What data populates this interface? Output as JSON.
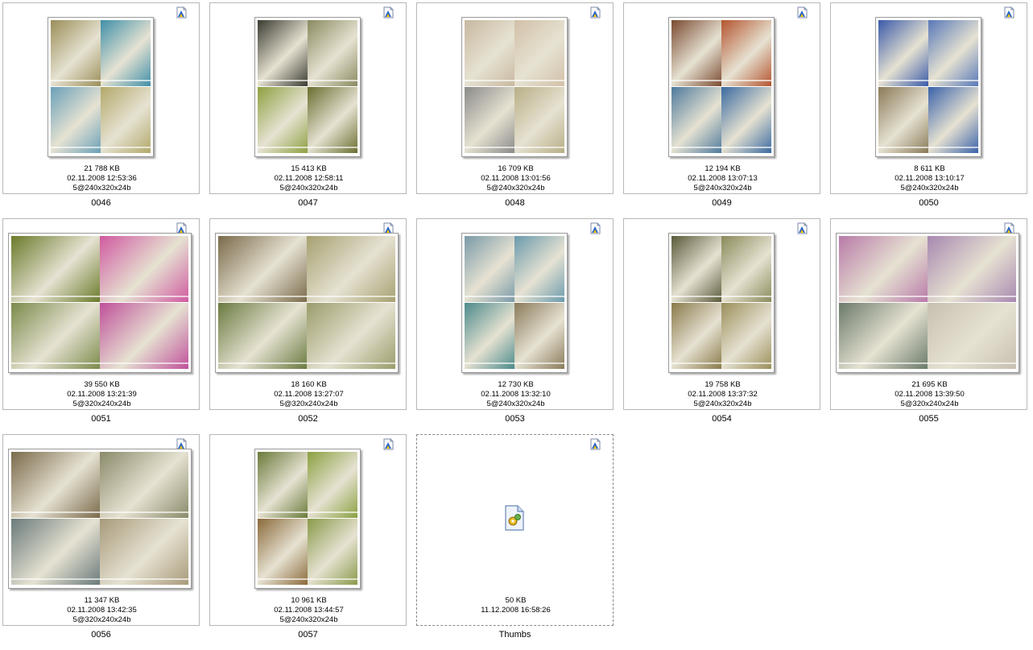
{
  "colors": {
    "border": "#b7b7b7",
    "badge_blue": "#2a63c6",
    "badge_yellow": "#f5c400"
  },
  "badge_icon": "image-file-icon",
  "items": [
    {
      "name": "0046",
      "size": "21 788 KB",
      "date": "02.11.2008 12:53:36",
      "info": "5@240x320x24b",
      "orientation": "portrait",
      "colors": [
        "#9a8e58",
        "#3f8fa8",
        "#6aa0b8",
        "#b2a86a"
      ]
    },
    {
      "name": "0047",
      "size": "15 413 KB",
      "date": "02.11.2008 12:58:11",
      "info": "5@240x320x24b",
      "orientation": "portrait",
      "colors": [
        "#3a3a30",
        "#8a8a60",
        "#8ea040",
        "#6a6e30"
      ]
    },
    {
      "name": "0048",
      "size": "16 709 KB",
      "date": "02.11.2008 13:01:56",
      "info": "5@240x320x24b",
      "orientation": "portrait",
      "colors": [
        "#c8b8a0",
        "#d2c0a8",
        "#8a8a88",
        "#b8ae86"
      ]
    },
    {
      "name": "0049",
      "size": "12 194 KB",
      "date": "02.11.2008 13:07:13",
      "info": "5@240x320x24b",
      "orientation": "portrait",
      "colors": [
        "#7a4a30",
        "#b4542e",
        "#4e7a9c",
        "#3a6aa0"
      ]
    },
    {
      "name": "0050",
      "size": "8 611 KB",
      "date": "02.11.2008 13:10:17",
      "info": "5@240x320x24b",
      "orientation": "portrait",
      "colors": [
        "#3a5aa8",
        "#5878b8",
        "#8a7a58",
        "#3a62aa"
      ]
    },
    {
      "name": "0051",
      "size": "39 550 KB",
      "date": "02.11.2008 13:21:39",
      "info": "5@320x240x24b",
      "orientation": "landscape",
      "colors": [
        "#6a7a2a",
        "#d05aa0",
        "#7a8a4a",
        "#c0509a"
      ]
    },
    {
      "name": "0052",
      "size": "18 160 KB",
      "date": "02.11.2008 13:27:07",
      "info": "5@320x240x24b",
      "orientation": "landscape",
      "colors": [
        "#7a6a4a",
        "#a6a070",
        "#6a7a40",
        "#9a9c6a"
      ]
    },
    {
      "name": "0053",
      "size": "12 730 KB",
      "date": "02.11.2008 13:32:10",
      "info": "5@240x320x24b",
      "orientation": "portrait",
      "colors": [
        "#7a9aa8",
        "#6a9aac",
        "#4a8a8a",
        "#8a7a5a"
      ]
    },
    {
      "name": "0054",
      "size": "19 758 KB",
      "date": "02.11.2008 13:37:32",
      "info": "5@240x320x24b",
      "orientation": "portrait",
      "colors": [
        "#5a5a3a",
        "#8a8a5a",
        "#8a7a4a",
        "#9a8e5a"
      ]
    },
    {
      "name": "0055",
      "size": "21 695 KB",
      "date": "02.11.2008 13:39:50",
      "info": "5@320x240x24b",
      "orientation": "landscape",
      "colors": [
        "#b87aa8",
        "#a888b0",
        "#6a7a6a",
        "#c8c0b0"
      ]
    },
    {
      "name": "0056",
      "size": "11 347 KB",
      "date": "02.11.2008 13:42:35",
      "info": "5@320x240x24b",
      "orientation": "landscape",
      "colors": [
        "#7a6a4a",
        "#8a8a6a",
        "#6a7a7a",
        "#a89a7a"
      ]
    },
    {
      "name": "0057",
      "size": "10 961 KB",
      "date": "02.11.2008 13:44:57",
      "info": "5@240x320x24b",
      "orientation": "portrait",
      "colors": [
        "#6a7a3a",
        "#8aa040",
        "#8a6a3a",
        "#8a9a4a"
      ]
    },
    {
      "name": "Thumbs",
      "size": "50 KB",
      "date": "11.12.2008 16:58:26",
      "info": "",
      "orientation": "none",
      "colors": []
    }
  ]
}
